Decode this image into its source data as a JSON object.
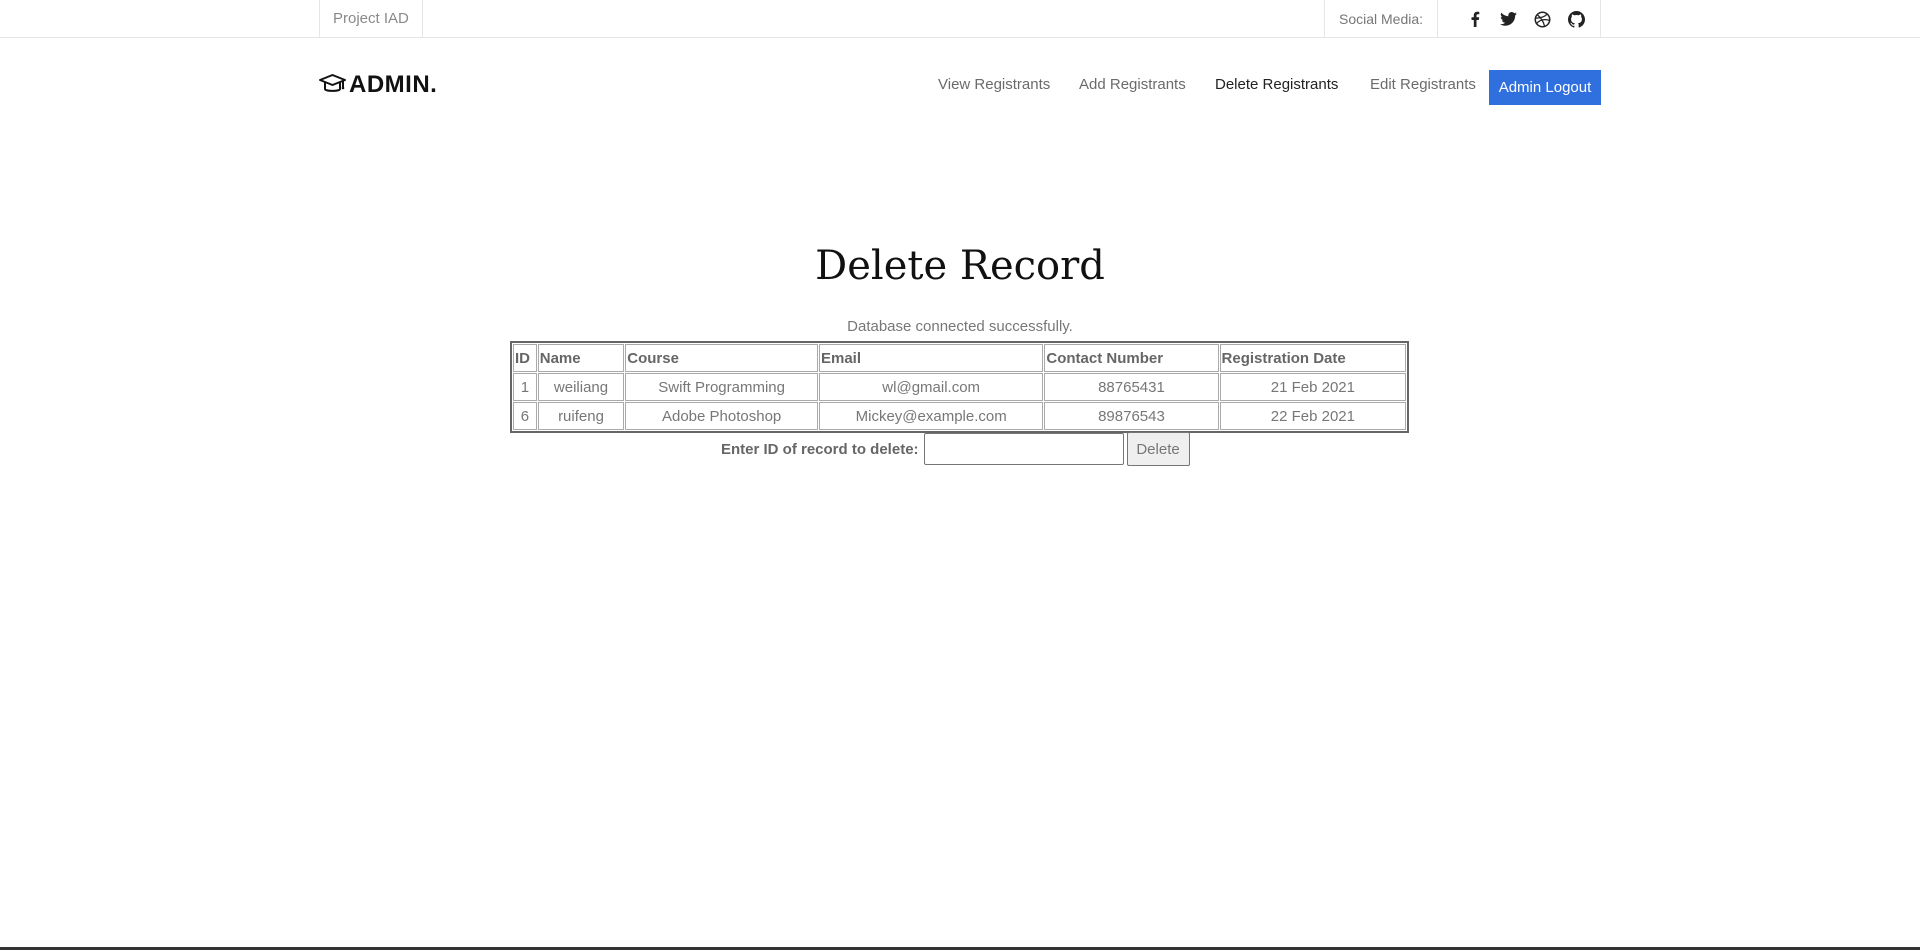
{
  "topbar": {
    "project": "Project IAD",
    "social_label": "Social Media:",
    "social_icons": [
      "facebook-icon",
      "twitter-icon",
      "dribbble-icon",
      "github-icon"
    ]
  },
  "brand": {
    "logo_text": "ADMIN.",
    "logo_icon": "graduation-cap-icon"
  },
  "nav": {
    "view": "View Registrants",
    "add": "Add Registrants",
    "delete": "Delete Registrants",
    "edit": "Edit Registrants",
    "logout": "Admin Logout"
  },
  "main": {
    "title": "Delete Record",
    "status": "Database connected successfully.",
    "table": {
      "headers": [
        "ID",
        "Name",
        "Course",
        "Email",
        "Contact Number",
        "Registration Date"
      ],
      "rows": [
        [
          "1",
          "weiliang",
          "Swift Programming",
          "wl@gmail.com",
          "88765431",
          "21 Feb 2021"
        ],
        [
          "6",
          "ruifeng",
          "Adobe Photoshop",
          "Mickey@example.com",
          "89876543",
          "22 Feb 2021"
        ]
      ]
    },
    "form": {
      "label": "Enter ID of record to delete:",
      "value": "",
      "button": "Delete"
    }
  },
  "colors": {
    "accent": "#2f6fde",
    "text": "#777777",
    "title": "#111111"
  }
}
